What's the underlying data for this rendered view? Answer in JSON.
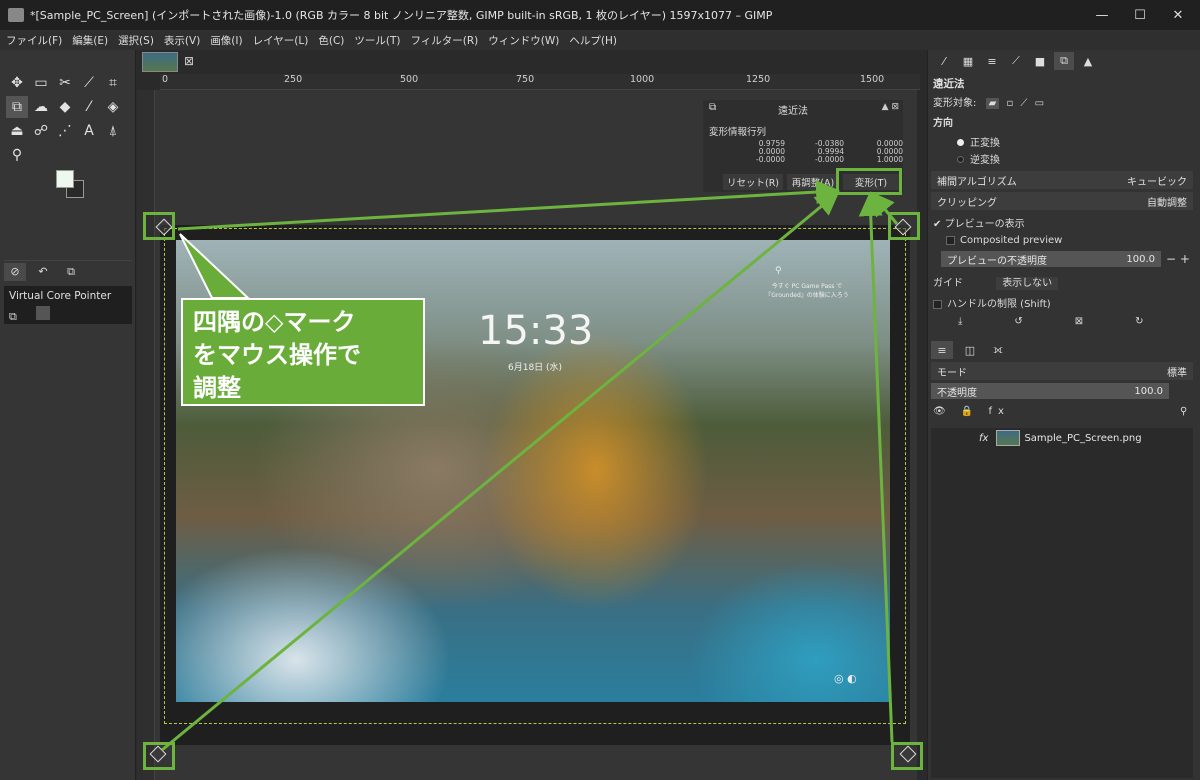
{
  "window": {
    "title": "*[Sample_PC_Screen] (インポートされた画像)-1.0 (RGB カラー 8 bit ノンリニア整数, GIMP built-in sRGB, 1 枚のレイヤー) 1597x1077 – GIMP",
    "minimize": "—",
    "maximize": "☐",
    "close": "✕"
  },
  "menu": [
    "ファイル(F)",
    "編集(E)",
    "選択(S)",
    "表示(V)",
    "画像(I)",
    "レイヤー(L)",
    "色(C)",
    "ツール(T)",
    "フィルター(R)",
    "ウィンドウ(W)",
    "ヘルプ(H)"
  ],
  "toolbox": {
    "device_label": "Virtual Core Pointer"
  },
  "ruler_h": [
    "0",
    "250",
    "500",
    "750",
    "1000",
    "1250",
    "1500"
  ],
  "perspective_dialog": {
    "title": "遠近法",
    "matrix_label": "変形情報行列",
    "matrix": [
      [
        "0.9759",
        "-0.0380",
        "0.0000"
      ],
      [
        "0.0000",
        "0.9994",
        "0.0000"
      ],
      [
        "-0.0000",
        "-0.0000",
        "1.0000"
      ]
    ],
    "reset": "リセット(R)",
    "readjust": "再調整(A)",
    "transform": "変形(T)"
  },
  "photo": {
    "clock": "15:33",
    "date": "6月18日 (水)",
    "search_hint": "今すぐ PC Game Pass で『Grounded』の体験に入ろう"
  },
  "callout": {
    "line1": "四隅の◇マーク",
    "line2": "をマウス操作で",
    "line3": "調整"
  },
  "tool_options": {
    "title": "遠近法",
    "transform_label": "変形対象:",
    "direction_label": "方向",
    "direction_normal": "正変換",
    "direction_reverse": "逆変換",
    "interpolation_label": "補間アルゴリズム",
    "interpolation_value": "キュービック",
    "clipping_label": "クリッピング",
    "clipping_value": "自動調整",
    "preview_label": "プレビューの表示",
    "composited_label": "Composited preview",
    "preview_opacity_label": "プレビューの不透明度",
    "preview_opacity_value": "100.0",
    "guide_label": "ガイド",
    "guide_value": "表示しない",
    "constrain_label": "ハンドルの制限 (Shift)"
  },
  "layers": {
    "mode_label": "モード",
    "mode_value": "標準",
    "opacity_label": "不透明度",
    "opacity_value": "100.0",
    "layer_name": "Sample_PC_Screen.png"
  },
  "colors": {
    "annotation_green": "#6db33f",
    "callout_fill": "#6aac3a"
  }
}
